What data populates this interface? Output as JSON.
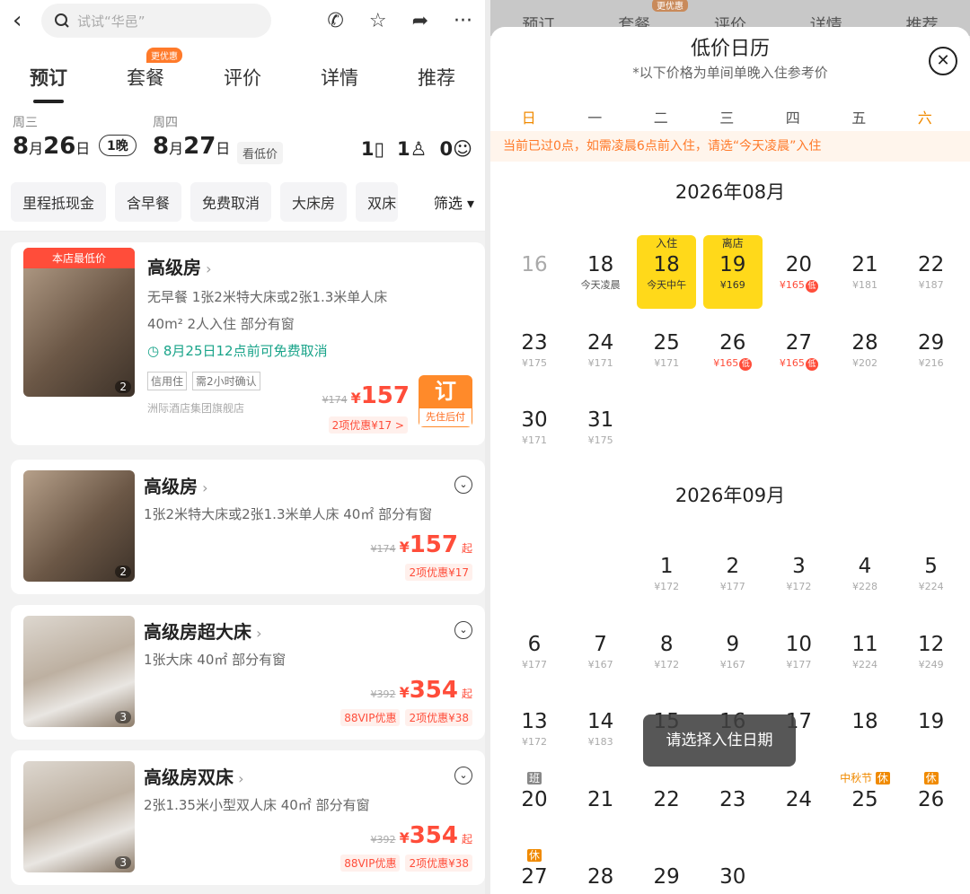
{
  "left": {
    "search_placeholder": "试试“华邑”",
    "tabs": [
      {
        "label": "预订",
        "active": true
      },
      {
        "label": "套餐",
        "badge": "更优惠"
      },
      {
        "label": "评价"
      },
      {
        "label": "详情"
      },
      {
        "label": "推荐"
      }
    ],
    "checkin": {
      "weekday": "周三",
      "month": "8",
      "month_unit": "月",
      "day": "26",
      "day_unit": "日"
    },
    "checkout": {
      "weekday": "周四",
      "month": "8",
      "month_unit": "月",
      "day": "27",
      "day_unit": "日"
    },
    "nights": "1晚",
    "low_price_tag": "看低价",
    "guests": {
      "rooms": "1",
      "adults": "1",
      "children": "0"
    },
    "filters": [
      "里程抵现金",
      "含早餐",
      "免费取消",
      "大床房",
      "双床"
    ],
    "filter_select": "筛选",
    "rooms": [
      {
        "ribbon": "本店最低价",
        "title": "高级房",
        "line1": "无早餐   1张2米特大床或2张1.3米单人床",
        "line2": "40m²   2人入住   部分有窗",
        "cancel": "8月25日12点前可免费取消",
        "tags": [
          "信用住",
          "需2小时确认"
        ],
        "vendor": "洲际酒店集团旗舰店",
        "orig": "¥174",
        "price": "157",
        "discount": "2项优惠¥17 >",
        "book": "订",
        "book_sub": "先住后付",
        "photo_count": "2"
      },
      {
        "title": "高级房",
        "line1": "1张2米特大床或2张1.3米单人床  40㎡  部分有窗",
        "orig": "¥174",
        "price": "157",
        "price_suffix": "起",
        "discount": "2项优惠¥17",
        "photo_count": "2"
      },
      {
        "title": "高级房超大床",
        "line1": "1张大床  40㎡  部分有窗",
        "orig": "¥392",
        "price": "354",
        "price_suffix": "起",
        "vip": "88VIP优惠",
        "discount": "2项优惠¥38",
        "photo_count": "3"
      },
      {
        "title": "高级房双床",
        "line1": "2张1.35米小型双人床  40㎡  部分有窗",
        "orig": "¥392",
        "price": "354",
        "price_suffix": "起",
        "vip": "88VIP优惠",
        "discount": "2项优惠¥38",
        "photo_count": "3"
      }
    ]
  },
  "calendar": {
    "bg_tabs": [
      "预订",
      "套餐",
      "评价",
      "详情",
      "推荐"
    ],
    "bg_badge": "更优惠",
    "title": "低价日历",
    "subtitle": "*以下价格为单间单晚入住参考价",
    "weekdays": [
      "日",
      "一",
      "二",
      "三",
      "四",
      "五",
      "六"
    ],
    "notice": "当前已过0点，如需凌晨6点前入住，请选“今天凌晨”入住",
    "month1": {
      "title": "2026年08月",
      "days": [
        {
          "col": 0,
          "row": 0,
          "num": "16",
          "disabled": true
        },
        {
          "col": 1,
          "row": 0,
          "num": "18",
          "sub": "今天凌晨",
          "dark": true
        },
        {
          "col": 2,
          "row": 0,
          "num": "18",
          "top": "入住",
          "sub": "今天中午",
          "selected": true
        },
        {
          "col": 3,
          "row": 0,
          "num": "19",
          "top": "离店",
          "sub": "¥169",
          "selected": true
        },
        {
          "col": 4,
          "row": 0,
          "num": "20",
          "sub": "¥165",
          "low": true
        },
        {
          "col": 5,
          "row": 0,
          "num": "21",
          "sub": "¥181"
        },
        {
          "col": 6,
          "row": 0,
          "num": "22",
          "sub": "¥187"
        },
        {
          "col": 0,
          "row": 1,
          "num": "23",
          "sub": "¥175"
        },
        {
          "col": 1,
          "row": 1,
          "num": "24",
          "sub": "¥171"
        },
        {
          "col": 2,
          "row": 1,
          "num": "25",
          "sub": "¥171"
        },
        {
          "col": 3,
          "row": 1,
          "num": "26",
          "sub": "¥165",
          "low": true
        },
        {
          "col": 4,
          "row": 1,
          "num": "27",
          "sub": "¥165",
          "low": true
        },
        {
          "col": 5,
          "row": 1,
          "num": "28",
          "sub": "¥202"
        },
        {
          "col": 6,
          "row": 1,
          "num": "29",
          "sub": "¥216"
        },
        {
          "col": 0,
          "row": 2,
          "num": "30",
          "sub": "¥171"
        },
        {
          "col": 1,
          "row": 2,
          "num": "31",
          "sub": "¥175"
        }
      ]
    },
    "month2": {
      "title": "2026年09月",
      "days": [
        {
          "col": 2,
          "row": 0,
          "num": "1",
          "sub": "¥172"
        },
        {
          "col": 3,
          "row": 0,
          "num": "2",
          "sub": "¥177"
        },
        {
          "col": 4,
          "row": 0,
          "num": "3",
          "sub": "¥172"
        },
        {
          "col": 5,
          "row": 0,
          "num": "4",
          "sub": "¥228"
        },
        {
          "col": 6,
          "row": 0,
          "num": "5",
          "sub": "¥224"
        },
        {
          "col": 0,
          "row": 1,
          "num": "6",
          "sub": "¥177"
        },
        {
          "col": 1,
          "row": 1,
          "num": "7",
          "sub": "¥167"
        },
        {
          "col": 2,
          "row": 1,
          "num": "8",
          "sub": "¥172"
        },
        {
          "col": 3,
          "row": 1,
          "num": "9",
          "sub": "¥167"
        },
        {
          "col": 4,
          "row": 1,
          "num": "10",
          "sub": "¥177"
        },
        {
          "col": 5,
          "row": 1,
          "num": "11",
          "sub": "¥224"
        },
        {
          "col": 6,
          "row": 1,
          "num": "12",
          "sub": "¥249"
        },
        {
          "col": 0,
          "row": 2,
          "num": "13",
          "sub": "¥172"
        },
        {
          "col": 1,
          "row": 2,
          "num": "14",
          "sub": "¥183"
        },
        {
          "col": 2,
          "row": 2,
          "num": "15",
          "sub": ""
        },
        {
          "col": 3,
          "row": 2,
          "num": "16",
          "sub": ""
        },
        {
          "col": 4,
          "row": 2,
          "num": "17",
          "sub": ""
        },
        {
          "col": 5,
          "row": 2,
          "num": "18",
          "sub": ""
        },
        {
          "col": 6,
          "row": 2,
          "num": "19",
          "sub": ""
        },
        {
          "col": 0,
          "row": 3,
          "num": "20",
          "top_ban": "班"
        },
        {
          "col": 1,
          "row": 3,
          "num": "21"
        },
        {
          "col": 2,
          "row": 3,
          "num": "22"
        },
        {
          "col": 3,
          "row": 3,
          "num": "23"
        },
        {
          "col": 4,
          "row": 3,
          "num": "24"
        },
        {
          "col": 5,
          "row": 3,
          "num": "25",
          "top_fest": "中秋节",
          "top_hol": "休"
        },
        {
          "col": 6,
          "row": 3,
          "num": "26",
          "top_hol": "休"
        },
        {
          "col": 0,
          "row": 4,
          "num": "27",
          "top_hol": "休"
        },
        {
          "col": 1,
          "row": 4,
          "num": "28"
        },
        {
          "col": 2,
          "row": 4,
          "num": "29"
        },
        {
          "col": 3,
          "row": 4,
          "num": "30"
        }
      ]
    },
    "toast": "请选择入住日期"
  }
}
